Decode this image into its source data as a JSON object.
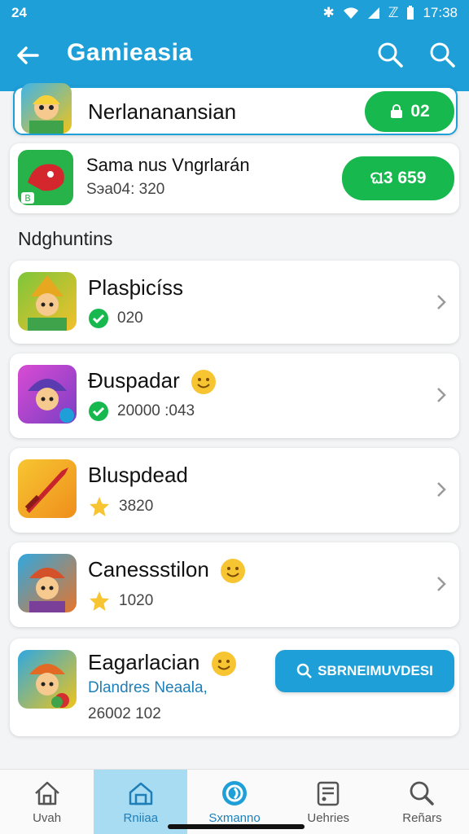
{
  "status_bar": {
    "left": "24",
    "time": "17:38"
  },
  "app_bar": {
    "title": "Gamieasia"
  },
  "top_card": {
    "name": "Nerlananansian",
    "button_label": "02"
  },
  "featured": {
    "name": "Sama nus Vngrlarán",
    "sub": "Sэа04: 320",
    "button_label": "ଘ3 659"
  },
  "section_title": "Ndghuntins",
  "games": [
    {
      "name": "Plasþicíss",
      "sub": "020",
      "badge": "check"
    },
    {
      "name": "Ɖuspadar",
      "sub": "20000 :043",
      "badge": "check"
    },
    {
      "name": "Bluspdead",
      "sub": "3820",
      "badge": "star"
    },
    {
      "name": "Canessstilon",
      "sub": "1020",
      "badge": "star"
    },
    {
      "name": "Eagarlacian",
      "sub_link": "Dlandres Neaala,",
      "sub": "26002 102",
      "button_label": "SBRNEIMUVDESI"
    }
  ],
  "bottom_nav": [
    {
      "label": "Uvah",
      "icon": "home-icon",
      "active": false
    },
    {
      "label": "Rniiaa",
      "icon": "library-icon",
      "active": true
    },
    {
      "label": "Sxmanno",
      "icon": "compass-icon",
      "active": false
    },
    {
      "label": "Uehries",
      "icon": "list-icon",
      "active": false
    },
    {
      "label": "Reñars",
      "icon": "search-icon",
      "active": false
    }
  ],
  "colors": {
    "primary": "#1e9fd8",
    "green": "#17b84e",
    "nav_active_bg": "#a8dcf3"
  }
}
